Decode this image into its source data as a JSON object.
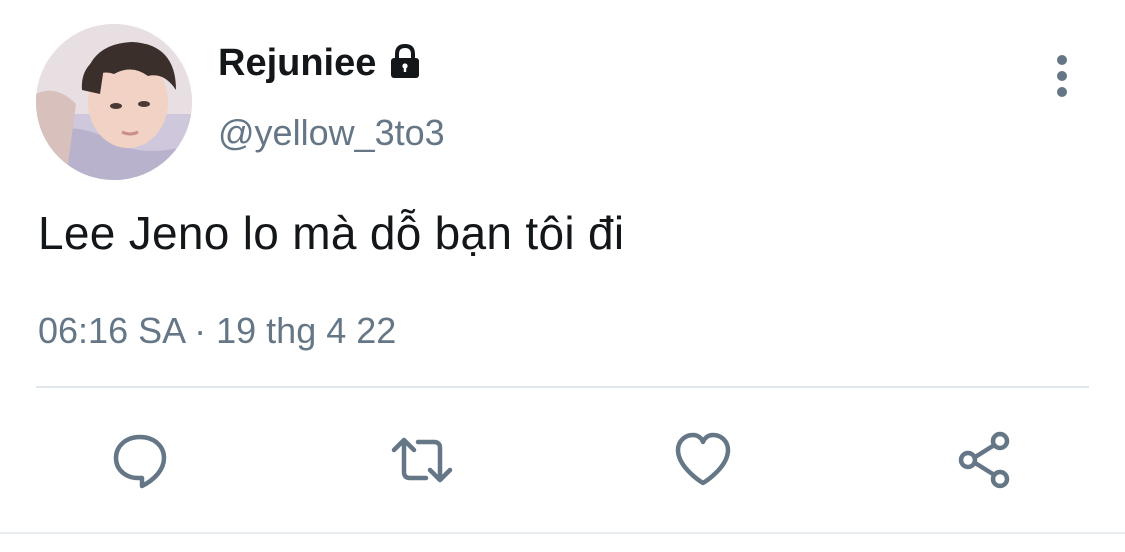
{
  "user": {
    "display_name": "Rejuniee",
    "handle": "@yellow_3to3",
    "protected_icon": "lock-icon",
    "avatar": "profile-photo"
  },
  "tweet": {
    "text": "Lee Jeno lo mà dỗ bạn tôi đi",
    "timestamp": "06:16 SA · 19 thg 4 22"
  },
  "actions": [
    {
      "name": "reply",
      "icon": "comment-bubble-icon"
    },
    {
      "name": "retweet",
      "icon": "retweet-arrows-icon"
    },
    {
      "name": "like",
      "icon": "heart-icon"
    },
    {
      "name": "share",
      "icon": "share-nodes-icon"
    }
  ],
  "menu_icon": "vertical-dots-icon",
  "colors": {
    "text_primary": "#14171a",
    "text_secondary": "#657786",
    "divider": "#e1e8ed"
  }
}
